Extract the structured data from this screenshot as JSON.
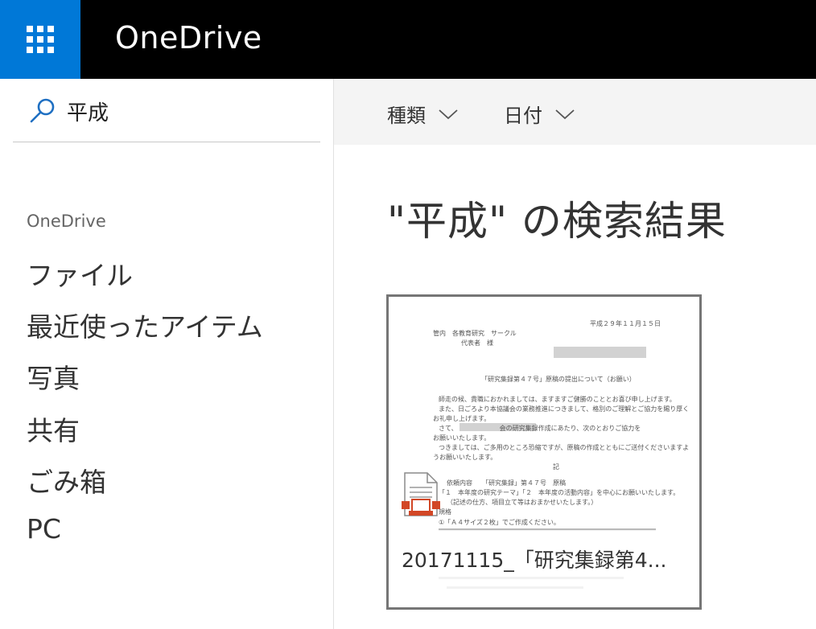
{
  "header": {
    "app_title": "OneDrive"
  },
  "search": {
    "query": "平成"
  },
  "sidebar": {
    "section_label": "OneDrive",
    "items": [
      {
        "label": "ファイル"
      },
      {
        "label": "最近使ったアイテム"
      },
      {
        "label": "写真"
      },
      {
        "label": "共有"
      },
      {
        "label": "ごみ箱"
      },
      {
        "label": "PC"
      }
    ]
  },
  "toolbar": {
    "filter_type": "種類",
    "filter_date": "日付"
  },
  "main": {
    "results_title": "\"平成\" の検索結果",
    "files": [
      {
        "name": "20171115_「研究集録第4...",
        "preview": {
          "date": "平成２９年１１月１５日",
          "to_line": "管内　各教育研究　サークル",
          "to_line2": "代表者　様",
          "subject": "「研究集録第４７号」原稿の提出について（お願い）",
          "body1": "師走の候、貴職におかれましては、ますますご健勝のこととお喜び申し上げます。",
          "body2": "また、日ごろより本協議会の業務推進につきまして、格別のご理解とご協力を賜り厚く",
          "body3": "お礼申し上げます。",
          "body4": "さて、　　　　　　　会の研究集録作成にあたり、次のとおりご協力を",
          "body5": "お願いいたします。",
          "body6": "つきましては、ご多用のところ恐縮ですが、原稿の作成とともにご送付くださいますよ",
          "body7": "うお願いいたします。",
          "ki": "記",
          "item1": "依頼内容　　「研究集録」第４７号　原稿",
          "item2": "「１　本年度の研究テーマ」「２　本年度の活動内容」を中心にお願いいたします。",
          "item3": "（記述の仕方、項目立て等はおまかせいたします。）",
          "item4": "規格",
          "item5": "①「Ａ４サイズ２枚」でご作成ください。"
        }
      }
    ]
  },
  "colors": {
    "brand_blue": "#0078d7",
    "topbar": "#000000",
    "doc_icon_accent": "#d24726"
  }
}
